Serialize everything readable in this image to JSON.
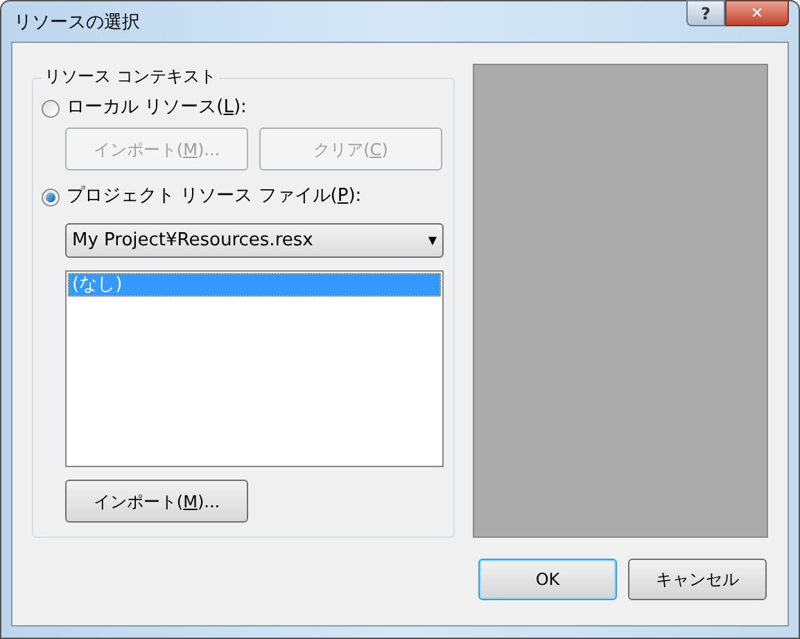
{
  "window": {
    "title": "リソースの選択",
    "help": "?",
    "close": "✕"
  },
  "group": {
    "title": "リソース コンテキスト",
    "options": [
      {
        "label": [
          "ローカル リソース(",
          "L",
          "):"
        ],
        "selected": false,
        "buttons": [
          {
            "label": [
              "インポート(",
              "M",
              ")..."
            ],
            "disabled": true
          },
          {
            "label": [
              "クリア(",
              "C",
              ")"
            ],
            "disabled": true
          }
        ]
      },
      {
        "label": [
          "プロジェクト リソース ファイル(",
          "P",
          "):"
        ],
        "selected": true
      }
    ],
    "dropdown": {
      "value": "My Project¥Resources.resx",
      "arrow": "▼"
    },
    "list": [
      {
        "text": "(なし)",
        "selected": true
      }
    ],
    "import_button": {
      "label": [
        "インポート(",
        "M",
        ")..."
      ],
      "disabled": false
    }
  },
  "buttons": [
    {
      "label": "OK",
      "default": true
    },
    {
      "label": "キャンセル",
      "default": false
    }
  ]
}
